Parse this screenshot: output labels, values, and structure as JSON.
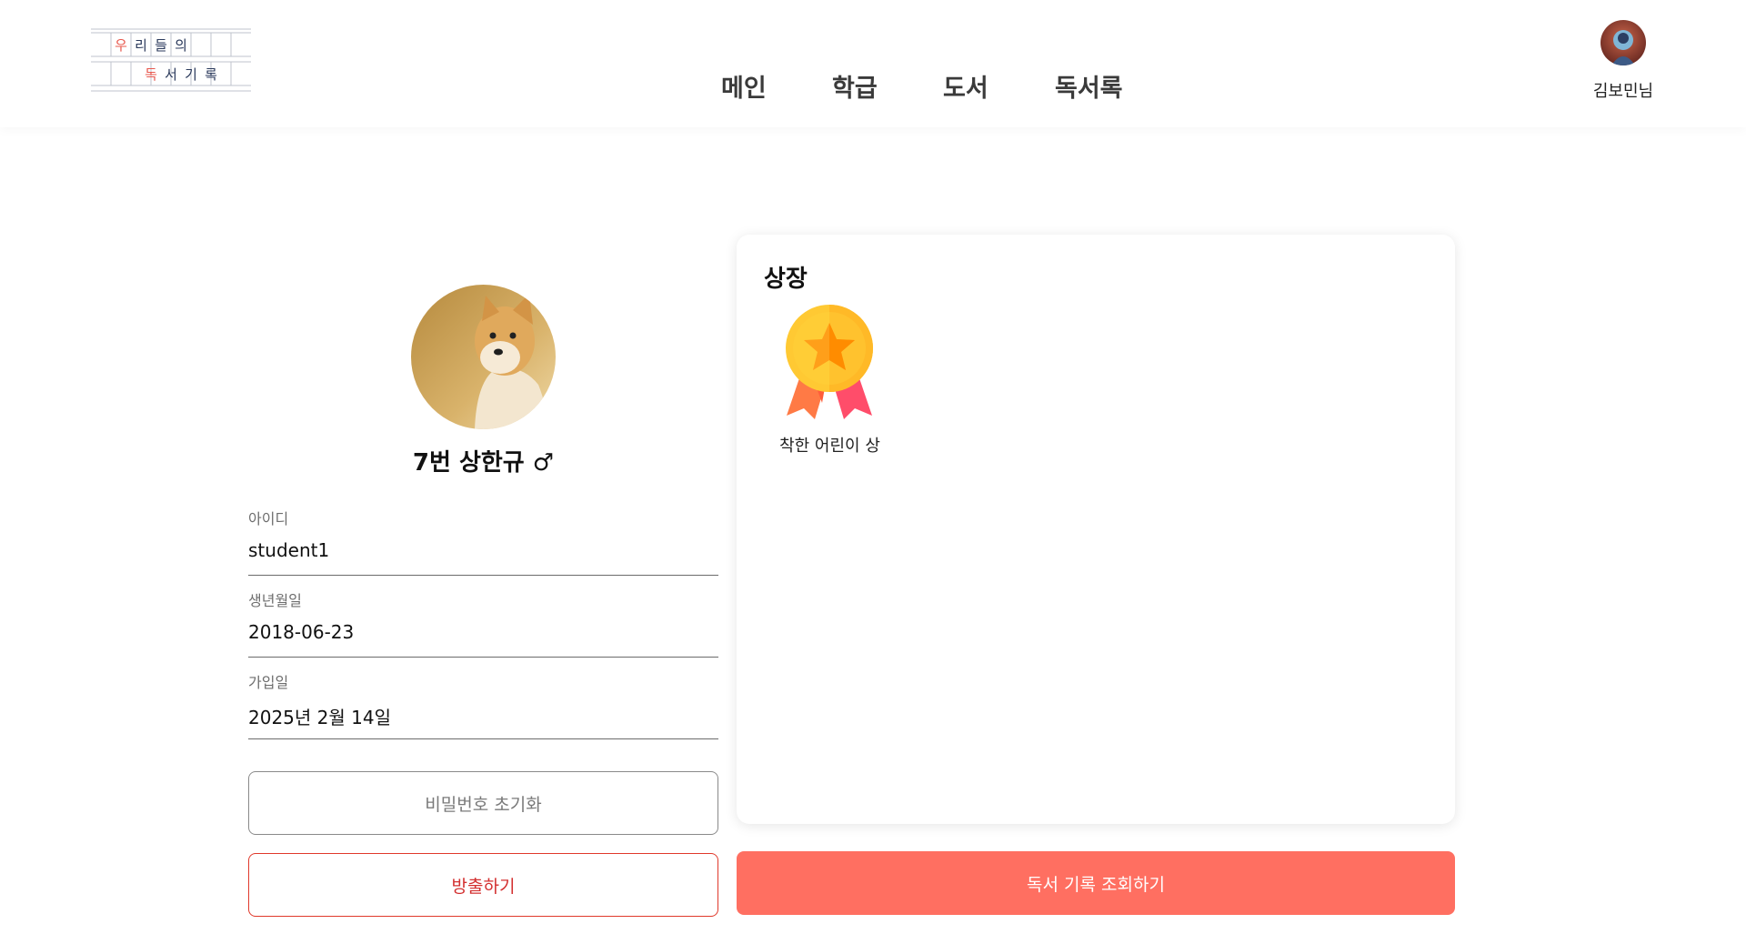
{
  "header": {
    "logo": {
      "row1": [
        "우",
        "리",
        "들",
        "의"
      ],
      "row2": [
        "독",
        "서",
        "기",
        "록"
      ]
    },
    "nav": [
      {
        "label": "메인"
      },
      {
        "label": "학급"
      },
      {
        "label": "도서"
      },
      {
        "label": "독서록"
      }
    ],
    "user": {
      "name": "김보민님"
    }
  },
  "profile": {
    "title": "7번 상한규 ♂",
    "fields": [
      {
        "label": "아이디",
        "value": "student1"
      },
      {
        "label": "생년월일",
        "value": "2018-06-23"
      },
      {
        "label": "가입일",
        "value": "2025년 2월 14일"
      }
    ],
    "reset_password_label": "비밀번호 초기화",
    "expel_label": "방출하기"
  },
  "awards": {
    "title": "상장",
    "items": [
      {
        "name": "착한 어린이 상",
        "icon": "medal-icon"
      }
    ]
  },
  "records_button_label": "독서 기록 조회하기",
  "colors": {
    "accent": "#ff6f61",
    "danger": "#d32f2f",
    "logo_red": "#e8584e",
    "logo_navy": "#2b3a5c"
  }
}
